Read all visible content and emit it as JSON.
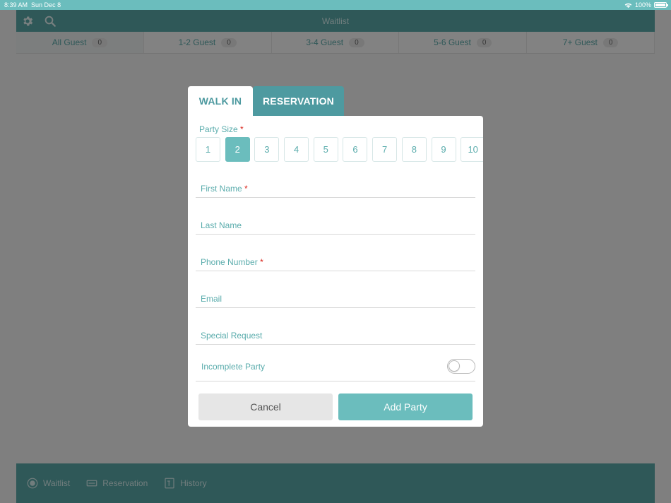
{
  "status": {
    "time": "8:39 AM",
    "date": "Sun Dec 8",
    "battery": "100%"
  },
  "header": {
    "title": "Waitlist"
  },
  "filters": [
    {
      "label": "All Guest",
      "count": "0"
    },
    {
      "label": "1-2 Guest",
      "count": "0"
    },
    {
      "label": "3-4 Guest",
      "count": "0"
    },
    {
      "label": "5-6 Guest",
      "count": "0"
    },
    {
      "label": "7+ Guest",
      "count": "0"
    }
  ],
  "nav": {
    "waitlist": "Waitlist",
    "reservation": "Reservation",
    "history": "History"
  },
  "modal": {
    "tabs": {
      "walkin": "WALK IN",
      "reservation": "RESERVATION"
    },
    "party_size_label": "Party Size",
    "required_mark": "*",
    "party_sizes": [
      "1",
      "2",
      "3",
      "4",
      "5",
      "6",
      "7",
      "8",
      "9",
      "10"
    ],
    "selected_size": "2",
    "fields": {
      "first_name": "First Name",
      "last_name": "Last Name",
      "phone": "Phone Number",
      "email": "Email",
      "special_request": "Special Request"
    },
    "incomplete_party": "Incomplete Party",
    "cancel": "Cancel",
    "add_party": "Add Party"
  }
}
